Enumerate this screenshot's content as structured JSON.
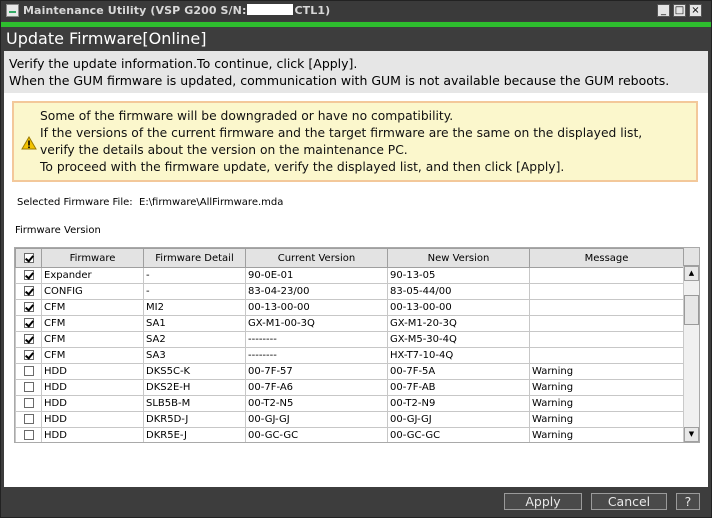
{
  "window": {
    "title_prefix": "Maintenance Utility (VSP G200 S/N:",
    "title_suffix": "CTL1)",
    "min_glyph": "_",
    "max_glyph": "□",
    "close_glyph": "×"
  },
  "page": {
    "title": "Update Firmware[Online]"
  },
  "info": {
    "line1": "Verify the update information.To continue, click [Apply].",
    "line2": "When the GUM firmware is updated, communication with GUM is not available because the GUM reboots."
  },
  "warning": {
    "icon": "warning-triangle-icon",
    "line1": "Some of the firmware will be downgraded or have no compatibility.",
    "line2": "If the versions of the current firmware and the target firmware are the same on the displayed list,",
    "line3": "verify the details about the version on the maintenance PC.",
    "line4": "To proceed with the firmware update, verify the displayed list, and then click [Apply]."
  },
  "file": {
    "label": "Selected Firmware File:",
    "value": "E:\\firmware\\AllFirmware.mda"
  },
  "firmware_version": {
    "label": "Firmware Version",
    "header_checked": true,
    "columns": [
      "Firmware",
      "Firmware Detail",
      "Current Version",
      "New Version",
      "Message"
    ],
    "rows": [
      {
        "checked": true,
        "firmware": "Expander",
        "detail": "-",
        "current": "90-0E-01",
        "new": "90-13-05",
        "message": ""
      },
      {
        "checked": true,
        "firmware": "CONFIG",
        "detail": "-",
        "current": "83-04-23/00",
        "new": "83-05-44/00",
        "message": ""
      },
      {
        "checked": true,
        "firmware": "CFM",
        "detail": "MI2",
        "current": "00-13-00-00",
        "new": "00-13-00-00",
        "message": ""
      },
      {
        "checked": true,
        "firmware": "CFM",
        "detail": "SA1",
        "current": "GX-M1-00-3Q",
        "new": "GX-M1-20-3Q",
        "message": ""
      },
      {
        "checked": true,
        "firmware": "CFM",
        "detail": "SA2",
        "current": "--------",
        "new": "GX-M5-30-4Q",
        "message": ""
      },
      {
        "checked": true,
        "firmware": "CFM",
        "detail": "SA3",
        "current": "--------",
        "new": "HX-T7-10-4Q",
        "message": ""
      },
      {
        "checked": false,
        "firmware": "HDD",
        "detail": "DKS5C-K",
        "current": "00-7F-57",
        "new": "00-7F-5A",
        "message": "Warning"
      },
      {
        "checked": false,
        "firmware": "HDD",
        "detail": "DKS2E-H",
        "current": "00-7F-A6",
        "new": "00-7F-AB",
        "message": "Warning"
      },
      {
        "checked": false,
        "firmware": "HDD",
        "detail": "SLB5B-M",
        "current": "00-T2-N5",
        "new": "00-T2-N9",
        "message": "Warning"
      },
      {
        "checked": false,
        "firmware": "HDD",
        "detail": "DKR5D-J",
        "current": "00-GJ-GJ",
        "new": "00-GJ-GJ",
        "message": "Warning"
      },
      {
        "checked": false,
        "firmware": "HDD",
        "detail": "DKR5E-J",
        "current": "00-GC-GC",
        "new": "00-GC-GC",
        "message": "Warning"
      }
    ]
  },
  "scrollbar": {
    "up_glyph": "▲",
    "down_glyph": "▼",
    "position": 0.12
  },
  "buttons": {
    "apply": "Apply",
    "cancel": "Cancel",
    "help": "?"
  },
  "colors": {
    "accent_green": "#2ebd2e",
    "warning_bg": "#fbf7cc",
    "warning_border": "#f3c89a"
  }
}
